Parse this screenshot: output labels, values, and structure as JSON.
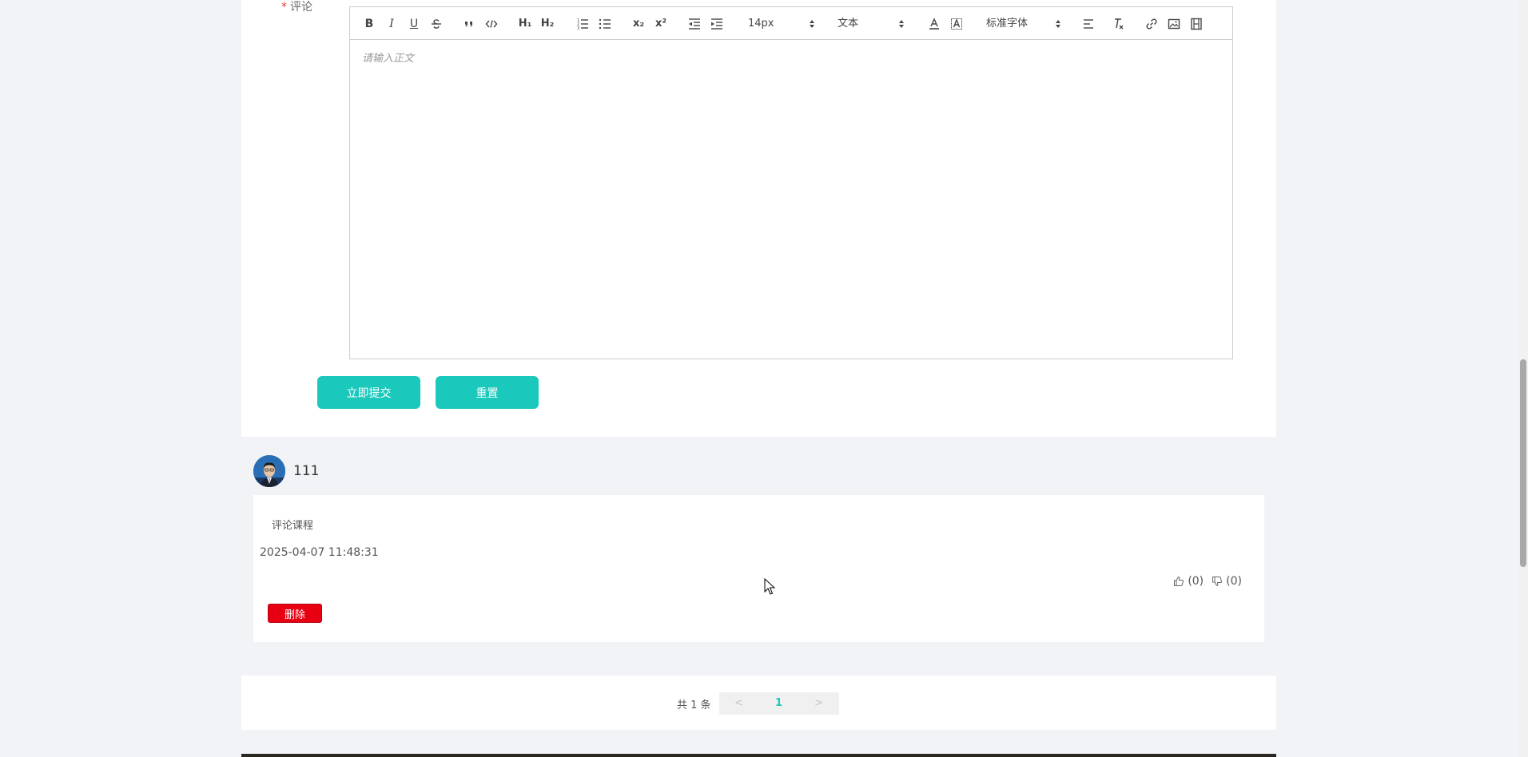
{
  "form": {
    "label": "评论",
    "required_mark": "*",
    "editor": {
      "placeholder": "请输入正文",
      "toolbar": {
        "bold": "B",
        "italic": "I",
        "underline": "U",
        "h1": "H₁",
        "h2": "H₂",
        "subscript": "x₂",
        "superscript": "x²",
        "font_size": "14px",
        "block_type": "文本",
        "font_family": "标准字体"
      }
    },
    "submit_label": "立即提交",
    "reset_label": "重置"
  },
  "comments": [
    {
      "user": "111",
      "text": "评论课程",
      "time": "2025-04-07 11:48:31",
      "likes": "(0)",
      "dislikes": "(0)",
      "delete_label": "删除"
    }
  ],
  "pagination": {
    "total": "共 1 条",
    "prev": "<",
    "current": "1",
    "next": ">"
  },
  "colors": {
    "accent": "#1bc9bc",
    "danger": "#e60012",
    "background": "#f2f3f7"
  }
}
